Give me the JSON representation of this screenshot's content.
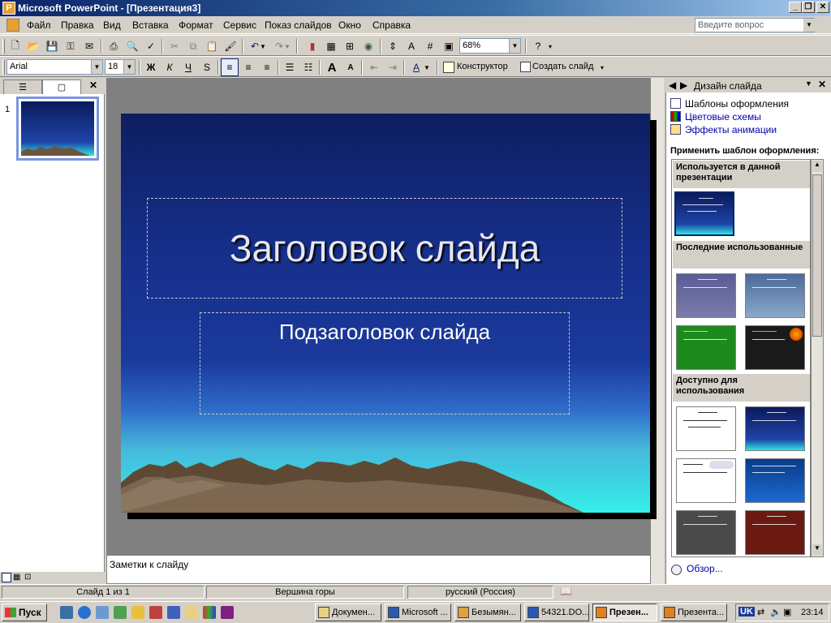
{
  "window": {
    "title": "Microsoft PowerPoint - [Презентация3]"
  },
  "menu": {
    "items": [
      "Файл",
      "Правка",
      "Вид",
      "Вставка",
      "Формат",
      "Сервис",
      "Показ слайдов",
      "Окно",
      "Справка"
    ],
    "ask_placeholder": "Введите вопрос"
  },
  "toolbar": {
    "zoom": "68%"
  },
  "formatting": {
    "font": "Arial",
    "size": "18",
    "designer": "Конструктор",
    "new_slide": "Создать слайд"
  },
  "slides_pane": {
    "thumb_number": "1"
  },
  "slide": {
    "title": "Заголовок слайда",
    "subtitle": "Подзаголовок слайда"
  },
  "notes": {
    "placeholder": "Заметки к слайду"
  },
  "task_pane": {
    "title": "Дизайн слайда",
    "links": [
      "Шаблоны оформления",
      "Цветовые схемы",
      "Эффекты анимации"
    ],
    "apply_label": "Применить шаблон оформления:",
    "sections": [
      "Используется в данной презентации",
      "Последние использованные",
      "Доступно для использования"
    ],
    "browse": "Обзор..."
  },
  "status": {
    "slide": "Слайд 1 из 1",
    "design": "Вершина горы",
    "language": "русский (Россия)"
  },
  "taskbar": {
    "start": "Пуск",
    "tasks": [
      "Докумен...",
      "Microsoft ...",
      "Безымян...",
      "54321.DO...",
      "Презен...",
      "Презента..."
    ],
    "lang": "UK",
    "clock": "23:14"
  }
}
